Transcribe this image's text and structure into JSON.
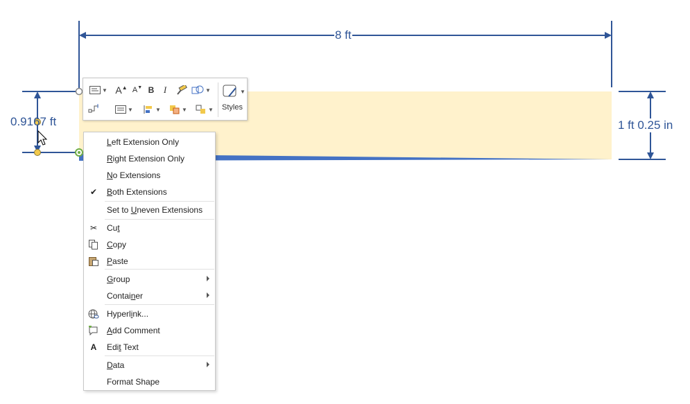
{
  "dimensions": {
    "horizontal_label": "8 ft",
    "left_vertical_label": "0.9167 ft",
    "right_vertical_label": "1 ft 0.25 in"
  },
  "colors": {
    "dimension_line": "#2f5597",
    "shape_fill": "#fff2cc",
    "shape_edge": "#4472c4",
    "handle_yellow": "#f2c94c",
    "handle_green": "#70ad47"
  },
  "mini_toolbar": {
    "buttons": [
      {
        "name": "text-box-icon"
      },
      {
        "name": "increase-font-size-icon"
      },
      {
        "name": "decrease-font-size-icon"
      },
      {
        "name": "bold",
        "glyph": "B"
      },
      {
        "name": "italic",
        "glyph": "I"
      },
      {
        "name": "format-painter-icon"
      },
      {
        "name": "shape-change-icon"
      },
      {
        "name": "connector-icon"
      },
      {
        "name": "text-align-icon"
      },
      {
        "name": "position-icon"
      },
      {
        "name": "bring-front-icon"
      },
      {
        "name": "send-back-icon"
      }
    ],
    "styles_label": "Styles"
  },
  "context_menu": {
    "items": [
      {
        "label_pre": "",
        "label_u": "L",
        "label_post": "eft Extension Only"
      },
      {
        "label_pre": "",
        "label_u": "R",
        "label_post": "ight Extension Only"
      },
      {
        "label_pre": "",
        "label_u": "N",
        "label_post": "o Extensions"
      },
      {
        "label_pre": "",
        "label_u": "B",
        "label_post": "oth Extensions",
        "checked": true
      },
      {
        "label_pre": "Set to ",
        "label_u": "U",
        "label_post": "neven Extensions"
      },
      {
        "label_pre": "Cu",
        "label_u": "t",
        "label_post": "",
        "icon": "scissors-icon"
      },
      {
        "label_pre": "",
        "label_u": "C",
        "label_post": "opy",
        "icon": "copy-icon"
      },
      {
        "label_pre": "",
        "label_u": "P",
        "label_post": "aste",
        "icon": "paste-icon"
      },
      {
        "label_pre": "",
        "label_u": "G",
        "label_post": "roup",
        "submenu": true
      },
      {
        "label_pre": "Contai",
        "label_u": "n",
        "label_post": "er",
        "submenu": true
      },
      {
        "label_pre": "Hyperl",
        "label_u": "i",
        "label_post": "nk...",
        "icon": "hyperlink-icon"
      },
      {
        "label_pre": "",
        "label_u": "A",
        "label_post": "dd Comment",
        "icon": "comment-icon"
      },
      {
        "label_pre": "Edi",
        "label_u": "t",
        "label_post": " Text",
        "icon": "edit-text-icon"
      },
      {
        "label_pre": "",
        "label_u": "D",
        "label_post": "ata",
        "submenu": true
      },
      {
        "label_pre": "Format Shape",
        "label_u": "",
        "label_post": ""
      }
    ]
  }
}
